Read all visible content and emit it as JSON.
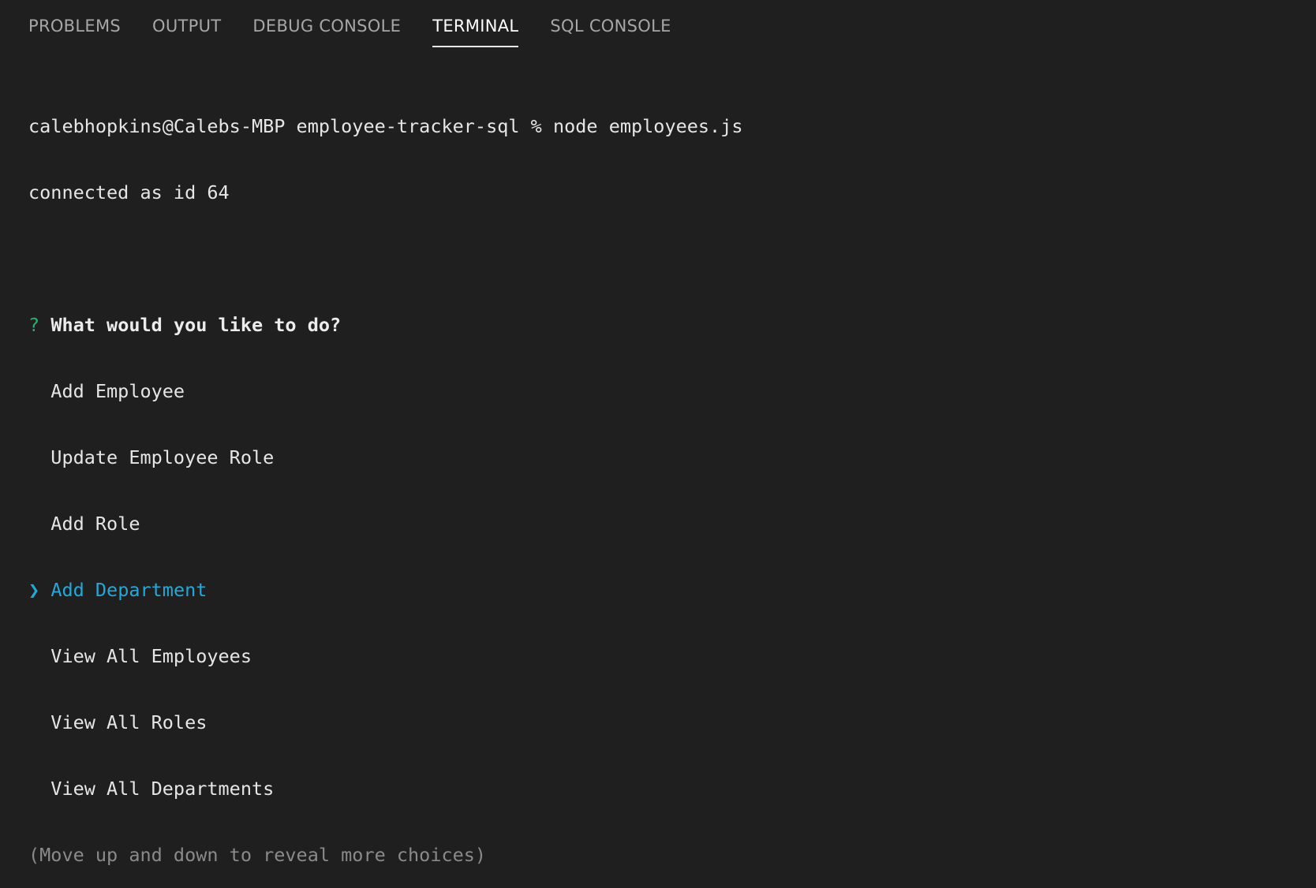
{
  "panel": {
    "tabs": [
      {
        "label": "PROBLEMS",
        "active": false
      },
      {
        "label": "OUTPUT",
        "active": false
      },
      {
        "label": "DEBUG CONSOLE",
        "active": false
      },
      {
        "label": "TERMINAL",
        "active": true
      },
      {
        "label": "SQL CONSOLE",
        "active": false
      }
    ]
  },
  "terminal": {
    "command_line": "calebhopkins@Calebs-MBP employee-tracker-sql % node employees.js",
    "connected_line": "connected as id 64",
    "prompt": {
      "marker": "?",
      "question": "What would you like to do?",
      "pointer": "❯",
      "choices": [
        {
          "label": "Add Employee",
          "selected": false
        },
        {
          "label": "Update Employee Role",
          "selected": false
        },
        {
          "label": "Add Role",
          "selected": false
        },
        {
          "label": "Add Department",
          "selected": true
        },
        {
          "label": "View All Employees",
          "selected": false
        },
        {
          "label": "View All Roles",
          "selected": false
        },
        {
          "label": "View All Departments",
          "selected": false
        }
      ],
      "hint": "(Move up and down to reveal more choices)"
    }
  },
  "colors": {
    "background": "#1f1f1f",
    "prompt_marker": "#23b56b",
    "selection": "#22a9d8",
    "hint": "#8a8a8a"
  }
}
